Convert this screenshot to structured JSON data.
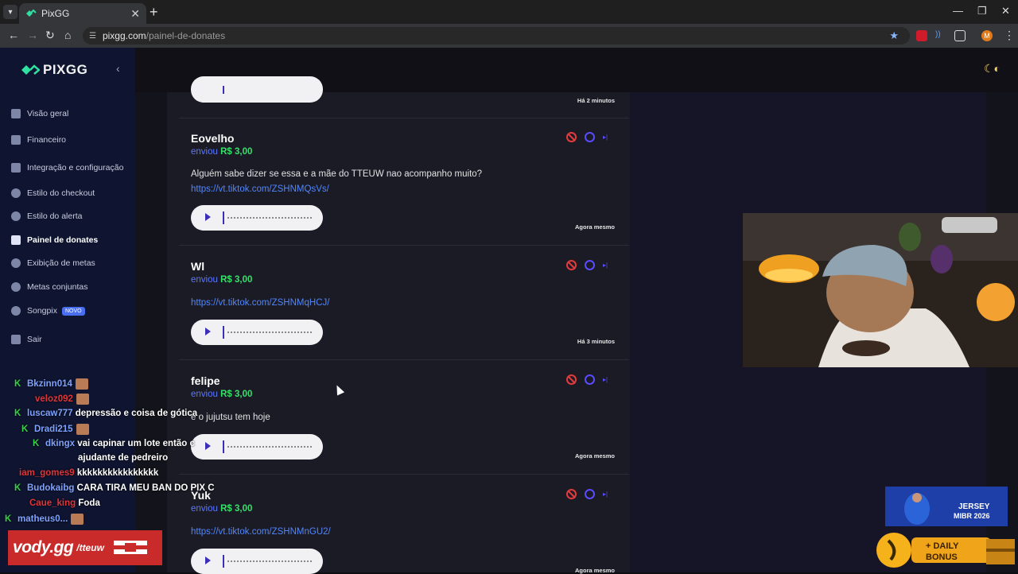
{
  "browser": {
    "tab_title": "PixGG",
    "url_host": "pixgg.com",
    "url_path": "/painel-de-donates",
    "profile_initial": "M"
  },
  "sidebar": {
    "brand": "PIXGG",
    "items": [
      {
        "label": "Visão geral",
        "icon": "home-icon"
      },
      {
        "label": "Financeiro",
        "icon": "wallet-icon"
      },
      {
        "label": "Integração e configuração",
        "icon": "settings-icon"
      },
      {
        "label": "Estilo do checkout",
        "icon": "palette-icon"
      },
      {
        "label": "Estilo do alerta",
        "icon": "palette-icon"
      },
      {
        "label": "Painel de donates",
        "icon": "people-icon",
        "active": true
      },
      {
        "label": "Exibição de metas",
        "icon": "star-icon"
      },
      {
        "label": "Metas conjuntas",
        "icon": "target-icon"
      },
      {
        "label": "Songpix",
        "icon": "music-icon",
        "badge": "NOVO"
      },
      {
        "label": "Sair",
        "icon": "logout-icon"
      }
    ]
  },
  "top_card": {
    "time": "Há 2 minutos"
  },
  "donations": [
    {
      "name": "Eovelho",
      "sent_label": "enviou",
      "amount": "R$ 3,00",
      "message": "Alguém sabe dizer se essa e a mãe do TTEUW nao acompanho muito?",
      "link": "https://vt.tiktok.com/ZSHNMQsVs/",
      "time": "Agora mesmo"
    },
    {
      "name": "Wl",
      "sent_label": "enviou",
      "amount": "R$ 3,00",
      "message": "",
      "link": "https://vt.tiktok.com/ZSHNMqHCJ/",
      "time": "Há 3 minutos"
    },
    {
      "name": "felipe",
      "sent_label": "enviou",
      "amount": "R$ 3,00",
      "message": "e o jujutsu tem hoje",
      "link": "",
      "time": "Agora mesmo"
    },
    {
      "name": "Yuk",
      "sent_label": "enviou",
      "amount": "R$ 3,00",
      "message": "",
      "link": "https://vt.tiktok.com/ZSHNMnGU2/",
      "time": "Agora mesmo"
    }
  ],
  "chat": [
    {
      "user": "Bkzinn014",
      "text": "",
      "color": "#7fa2ff"
    },
    {
      "user": "veloz092",
      "text": "",
      "color": "#e0353b"
    },
    {
      "user": "luscaw777",
      "text": "depressão e coisa de gótica",
      "color": "#7fa2ff"
    },
    {
      "user": "Dradi215",
      "text": "",
      "color": "#7fa2ff"
    },
    {
      "user": "dkingx",
      "text": "vai capinar um lote então c",
      "color": "#7fa2ff"
    },
    {
      "user": "",
      "text": "ajudante de pedreiro",
      "color": "#ffffff"
    },
    {
      "user": "iam_gomes9",
      "text": "kkkkkkkkkkkkkkkk",
      "color": "#e0353b"
    },
    {
      "user": "Budokaibg",
      "text": "CARA TIRA MEU BAN DO PIX C",
      "color": "#7fa2ff"
    },
    {
      "user": "Caue_king",
      "text": "Foda",
      "color": "#e0353b"
    },
    {
      "user": "matheus0...",
      "text": "",
      "color": "#7fa2ff"
    }
  ],
  "overlays": {
    "vody_logo": "vody.gg",
    "vody_channel": "/tteuw",
    "jersey_line1": "JERSEY",
    "jersey_line2": "MIBR 2026",
    "bonus_line1": "+ DAILY",
    "bonus_line2": "BONUS"
  }
}
